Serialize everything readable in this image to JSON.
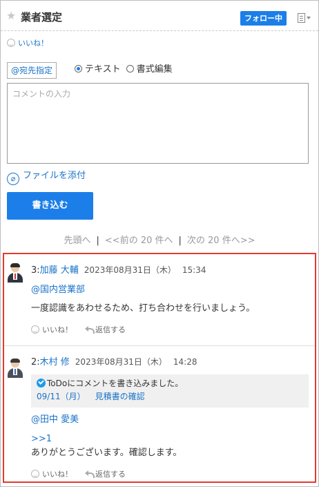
{
  "header": {
    "title": "業者選定",
    "follow_label": "フォロー中"
  },
  "like_top": "いいね！",
  "composer": {
    "mention_label": "@宛先指定",
    "radio_text": "テキスト",
    "radio_rich": "書式編集",
    "selected_mode": "テキスト",
    "comment_placeholder": "コメントの入力",
    "attach_label": "ファイルを添付",
    "submit_label": "書き込む"
  },
  "pager": {
    "first": "先頭へ",
    "prev": "<<前の 20 件へ",
    "next": "次の 20 件へ>>"
  },
  "comments": [
    {
      "number": "3:",
      "user": "加藤 大輔",
      "date": "2023年08月31日（木）",
      "time": "15:34",
      "mention": "@国内営業部",
      "body": "一度認識をあわせるため、打ち合わせを行いましょう。",
      "like": "いいね！",
      "reply": "返信する"
    },
    {
      "number": "2:",
      "user": "木村 修",
      "date": "2023年08月31日（木）",
      "time": "14:28",
      "todo_line1": "ToDoにコメントを書き込みました。",
      "todo_date": "09/11（月）",
      "todo_task": "見積書の確認",
      "mention": "@田中 愛美",
      "anchor": ">>1",
      "body": "ありがとうございます。確認します。",
      "like": "いいね！",
      "reply": "返信する"
    }
  ],
  "colors": {
    "accent": "#1c7ee8",
    "link": "#1a73c8",
    "highlight_border": "#e23a2e"
  },
  "icons": {
    "star": "star-icon",
    "menu": "list-menu-icon",
    "like": "smile-icon",
    "attach": "paperclip-icon",
    "reply": "reply-arrow-icon",
    "todo": "check-circle-icon",
    "avatar": "user-avatar"
  }
}
